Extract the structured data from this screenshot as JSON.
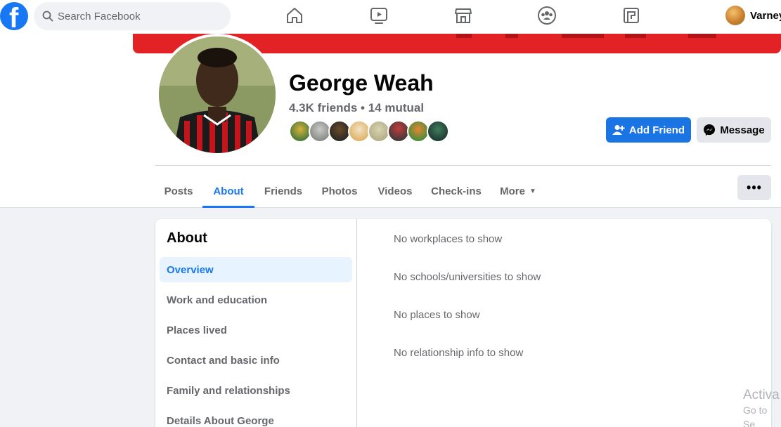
{
  "search": {
    "placeholder": "Search Facebook"
  },
  "nav": {
    "icons": [
      "home-icon",
      "watch-icon",
      "marketplace-icon",
      "groups-icon",
      "gaming-icon"
    ]
  },
  "account": {
    "name": "Varney"
  },
  "profile": {
    "name": "George Weah",
    "friends_text": "4.3K friends • 14 mutual",
    "add_friend_label": "Add Friend",
    "message_label": "Message",
    "more_button_label": "•••"
  },
  "tabs": [
    {
      "label": "Posts",
      "active": false
    },
    {
      "label": "About",
      "active": true
    },
    {
      "label": "Friends",
      "active": false
    },
    {
      "label": "Photos",
      "active": false
    },
    {
      "label": "Videos",
      "active": false
    },
    {
      "label": "Check-ins",
      "active": false
    },
    {
      "label": "More",
      "active": false
    }
  ],
  "about": {
    "title": "About",
    "items": [
      {
        "label": "Overview",
        "active": true
      },
      {
        "label": "Work and education",
        "active": false
      },
      {
        "label": "Places lived",
        "active": false
      },
      {
        "label": "Contact and basic info",
        "active": false
      },
      {
        "label": "Family and relationships",
        "active": false
      },
      {
        "label": "Details About George",
        "active": false
      }
    ],
    "lines": [
      "No workplaces to show",
      "No schools/universities to show",
      "No places to show",
      "No relationship info to show"
    ]
  },
  "watermark": {
    "line1": "Activa",
    "line2": "Go to Se"
  },
  "colors": {
    "brand": "#1877f2",
    "button_blue": "#1b74e4",
    "cover": "#e32226"
  }
}
